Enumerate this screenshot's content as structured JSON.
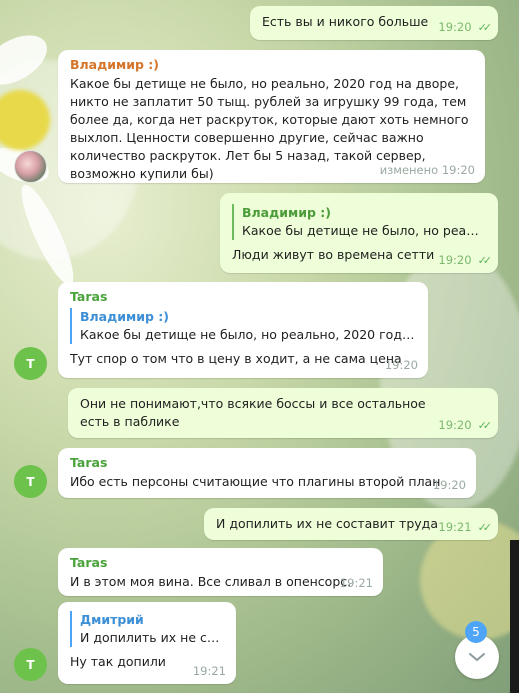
{
  "messages": {
    "m1": {
      "text": "Есть вы и никого больше",
      "time": "19:20"
    },
    "m2": {
      "sender": "Владимир :)",
      "text": "Какое бы детище не было, но реально, 2020 год на дворе, никто не заплатит 50 тыщ. рублей за игрушку 99 года, тем более да, когда нет раскруток, которые дают хоть немного выхлоп. Ценности совершенно другие, сейчас важно количество раскруток. Лет бы 5 назад, такой сервер, возможно купили бы)",
      "time": "изменено 19:20"
    },
    "m3": {
      "quote_name": "Владимир :)",
      "quote_text": "Какое бы детище не было, но реальн...",
      "text": "Люди живут во времена сетти",
      "time": "19:20"
    },
    "m4": {
      "sender": "Taras",
      "quote_name": "Владимир :)",
      "quote_text": "Какое бы детище не было, но реально, 2020 год на д...",
      "text": "Тут спор о том что в цену в ходит, а не сама цена",
      "time": "19:20"
    },
    "m5": {
      "text": "Они не понимают,что всякие боссы и все остальное есть в паблике",
      "time": "19:20"
    },
    "m6": {
      "sender": "Taras",
      "text": "Ибо есть персоны считающие что плагины второй план",
      "time": "19:20"
    },
    "m7": {
      "text": "И допилить их не составит труда",
      "time": "19:21"
    },
    "m8": {
      "sender": "Taras",
      "text": "И в этом моя вина. Все сливал в опенсорс.",
      "time": "19:21"
    },
    "m9": {
      "quote_name": "Дмитрий",
      "quote_text": "И допилить их не сос...",
      "text": "Ну так допили",
      "time": "19:21"
    }
  },
  "avatars": {
    "taras_initial": "T"
  },
  "scroll": {
    "unread_count": "5"
  },
  "colors": {
    "sender_vladimir": "#d4752b",
    "sender_taras": "#4aa33a",
    "quote_accent": "#4ea4f6",
    "outgoing_bg": "#eefed8"
  }
}
